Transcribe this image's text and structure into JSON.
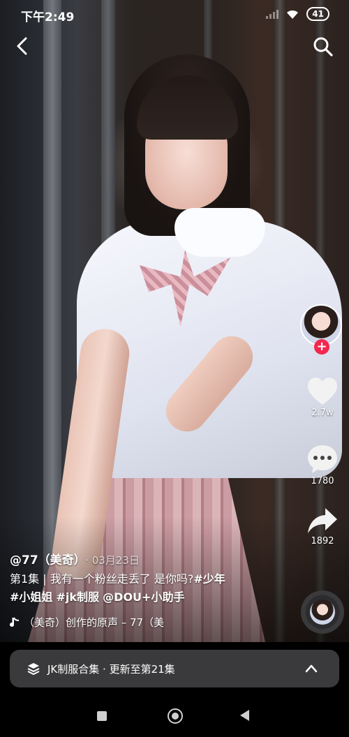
{
  "status_bar": {
    "time": "下午2:49",
    "battery": "41"
  },
  "actions": {
    "like_count": "2.7w",
    "comment_count": "1780",
    "share_count": "1892"
  },
  "post": {
    "author": "@77（美奇）",
    "date": "· 03月23日",
    "description_text": "第1集 | 我有一个粉丝走丢了 是你吗?",
    "hashtags": [
      "#少年",
      "#小姐姐",
      "#jk制服"
    ],
    "mention": "@DOU+小助手",
    "music": "（美奇）创作的原声 – 77（美"
  },
  "collection": {
    "label": "JK制服合集 · 更新至第21集"
  },
  "colors": {
    "follow_red": "#f2284f",
    "collection_bg": "#3a3a3c"
  }
}
